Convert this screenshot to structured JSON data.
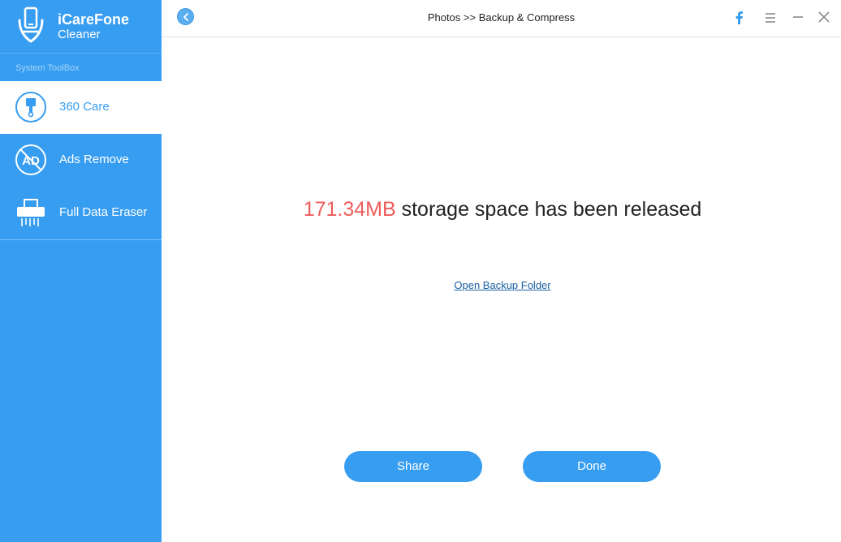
{
  "app": {
    "name": "iCareFone",
    "subtitle": "Cleaner"
  },
  "sidebar": {
    "section_label": "System ToolBox",
    "items": [
      {
        "label": "360 Care",
        "icon": "brush-icon",
        "active": true
      },
      {
        "label": "Ads Remove",
        "icon": "ad-block-icon",
        "active": false
      },
      {
        "label": "Full Data Eraser",
        "icon": "shredder-icon",
        "active": false
      }
    ]
  },
  "header": {
    "breadcrumb": "Photos >> Backup & Compress",
    "icons": [
      "back-icon",
      "facebook-icon",
      "menu-icon",
      "minimize-icon",
      "close-icon"
    ]
  },
  "main": {
    "released_amount": "171.34MB",
    "released_text": " storage space has been released",
    "open_folder_link": "Open Backup Folder",
    "share_label": "Share",
    "done_label": "Done"
  },
  "colors": {
    "accent": "#379df1",
    "highlight": "#ef5c5c",
    "link": "#1a5fa0"
  }
}
